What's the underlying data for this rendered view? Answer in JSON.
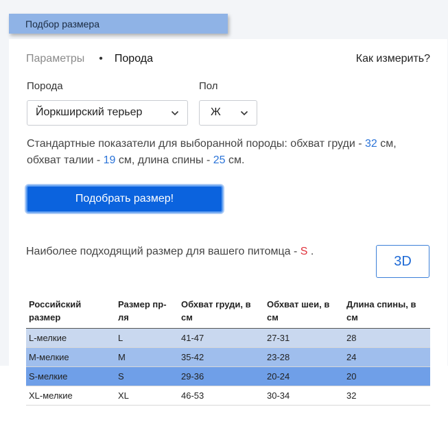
{
  "header": {
    "title": "Подбор размера"
  },
  "steps": {
    "params": "Параметры",
    "separator": "•",
    "breed": "Порода"
  },
  "how_to_measure": "Как измерить?",
  "form": {
    "breed_label": "Порода",
    "breed_value": "Йоркширский терьер",
    "sex_label": "Пол",
    "sex_value": "Ж"
  },
  "info": {
    "prefix": "Стандартные показатели для выборанной породы: обхват груди - ",
    "chest": "32",
    "mid1": " см, обхват талии - ",
    "waist": "19",
    "mid2": " см, длина спины - ",
    "back": "25",
    "suffix": " см."
  },
  "pick_button": "Подобрать размер!",
  "result": {
    "text": "Наиболее подходящий размер для вашего питомца - ",
    "size": "S",
    "end": " ."
  },
  "btn_3d": "3D",
  "table": {
    "headers": [
      "Российский размер",
      "Размер пр-ля",
      "Обхват груди, в см",
      "Обхват шеи, в см",
      "Длина спины, в см"
    ],
    "rows": [
      [
        "L-мелкие",
        "L",
        "41-47",
        "27-31",
        "28"
      ],
      [
        "M-мелкие",
        "M",
        "35-42",
        "23-28",
        "24"
      ],
      [
        "S-мелкие",
        "S",
        "29-36",
        "20-24",
        "20"
      ],
      [
        "XL-мелкие",
        "XL",
        "46-53",
        "30-34",
        "32"
      ]
    ]
  },
  "colors": {
    "primary": "#0b63de",
    "accent_text": "#2a73d8",
    "result_size": "#e0303a",
    "row_l": "#c9d8ef",
    "row_m": "#9fbeed",
    "row_s": "#6f9fe8"
  },
  "icons": {
    "select_arrow": "chevron-down-icon"
  }
}
